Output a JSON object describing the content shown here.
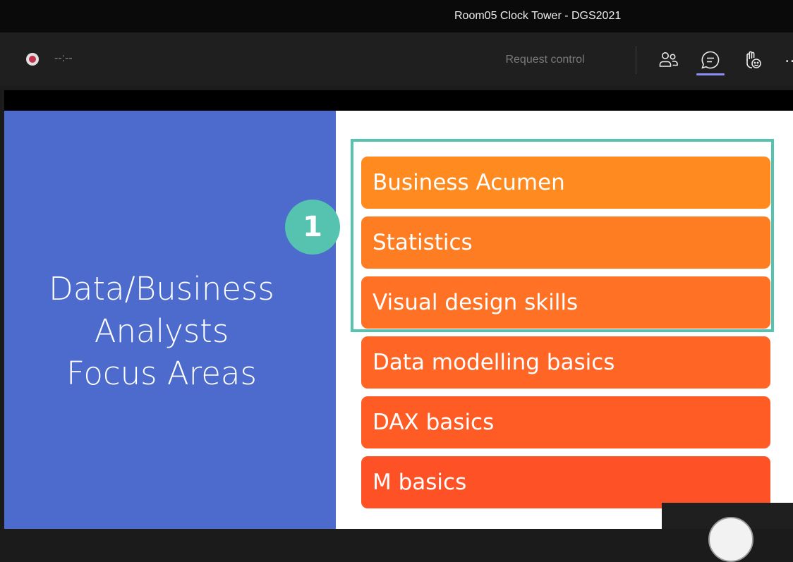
{
  "window": {
    "title": "Room05 Clock Tower - DGS2021"
  },
  "toolbar": {
    "recording_timer": "--:--",
    "request_control_label": "Request control",
    "icons": [
      "participants-icon",
      "chat-icon",
      "raise-hand-reactions-icon",
      "more-options-icon"
    ],
    "more_label": "…"
  },
  "slide": {
    "heading": "Data/Business\nAnalysts\nFocus Areas",
    "step_number": "1",
    "focus_areas": [
      {
        "label": "Business Acumen",
        "color": "#ff8a1f"
      },
      {
        "label": "Statistics",
        "color": "#ff7d22"
      },
      {
        "label": "Visual design skills",
        "color": "#ff7124"
      },
      {
        "label": "Data modelling basics",
        "color": "#ff6625"
      },
      {
        "label": "DAX basics",
        "color": "#ff5b25"
      },
      {
        "label": "M basics",
        "color": "#ff5126"
      }
    ],
    "panel_color": "#4c6bcd",
    "highlight_color": "#55c3b0"
  }
}
